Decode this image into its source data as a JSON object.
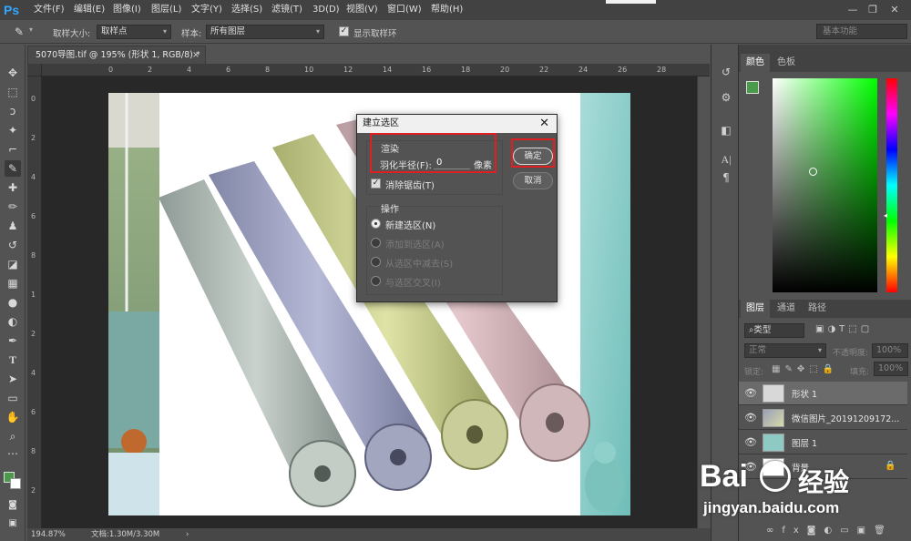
{
  "app": {
    "logo": "Ps"
  },
  "menu": [
    "文件(F)",
    "编辑(E)",
    "图像(I)",
    "图层(L)",
    "文字(Y)",
    "选择(S)",
    "滤镜(T)",
    "3D(D)",
    "视图(V)",
    "窗口(W)",
    "帮助(H)"
  ],
  "window_controls": {
    "minimize": "—",
    "restore": "❐",
    "close": "✕"
  },
  "options": {
    "sample_size_label": "取样大小:",
    "sample_size_value": "取样点",
    "sample_label": "样本:",
    "sample_value": "所有图层",
    "show_ring_label": "显示取样环",
    "workspace": "基本功能"
  },
  "document": {
    "tab_title": "5070导图.tif @ 195% (形状 1, RGB/8) *",
    "tab_close": "×",
    "zoom": "194.87%",
    "doc_info": "文档:1.30M/3.30M"
  },
  "ruler_h": [
    "0",
    "2",
    "4",
    "6",
    "8",
    "10",
    "12",
    "14",
    "16",
    "18",
    "20",
    "22",
    "24",
    "26",
    "28"
  ],
  "ruler_v": [
    "0",
    "2",
    "4",
    "6",
    "8",
    "1",
    "2",
    "4",
    "6",
    "8",
    "2"
  ],
  "dialog": {
    "title": "建立选区",
    "close": "✕",
    "render_group": "渲染",
    "feather_label": "羽化半径(F):",
    "feather_value": "0",
    "feather_unit": "像素",
    "antialias_label": "消除锯齿(T)",
    "ok": "确定",
    "cancel": "取消",
    "operation_group": "操作",
    "op_new": "新建选区(N)",
    "op_add": "添加到选区(A)",
    "op_subtract": "从选区中减去(S)",
    "op_intersect": "与选区交叉(I)"
  },
  "color_panel": {
    "tabs": [
      "颜色",
      "色板"
    ],
    "fg_color": "#4a9a4a",
    "hue_color": "#00ff00"
  },
  "layers_panel": {
    "tabs": [
      "图层",
      "通道",
      "路径"
    ],
    "kind_filter": "类型",
    "blend_mode": "正常",
    "opacity_label": "不透明度:",
    "opacity_value": "100%",
    "lock_label": "锁定:",
    "fill_label": "填充:",
    "fill_value": "100%",
    "layers": [
      {
        "name": "形状 1"
      },
      {
        "name": "微信图片_20191209172..."
      },
      {
        "name": "图层 1"
      },
      {
        "name": "背景"
      }
    ]
  },
  "watermark": {
    "brand": "Bai",
    "brand2": "经验",
    "url": "jingyan.baidu.com"
  },
  "accent": {
    "ps_blue": "#31a8ff",
    "highlight_red": "#e02020"
  }
}
